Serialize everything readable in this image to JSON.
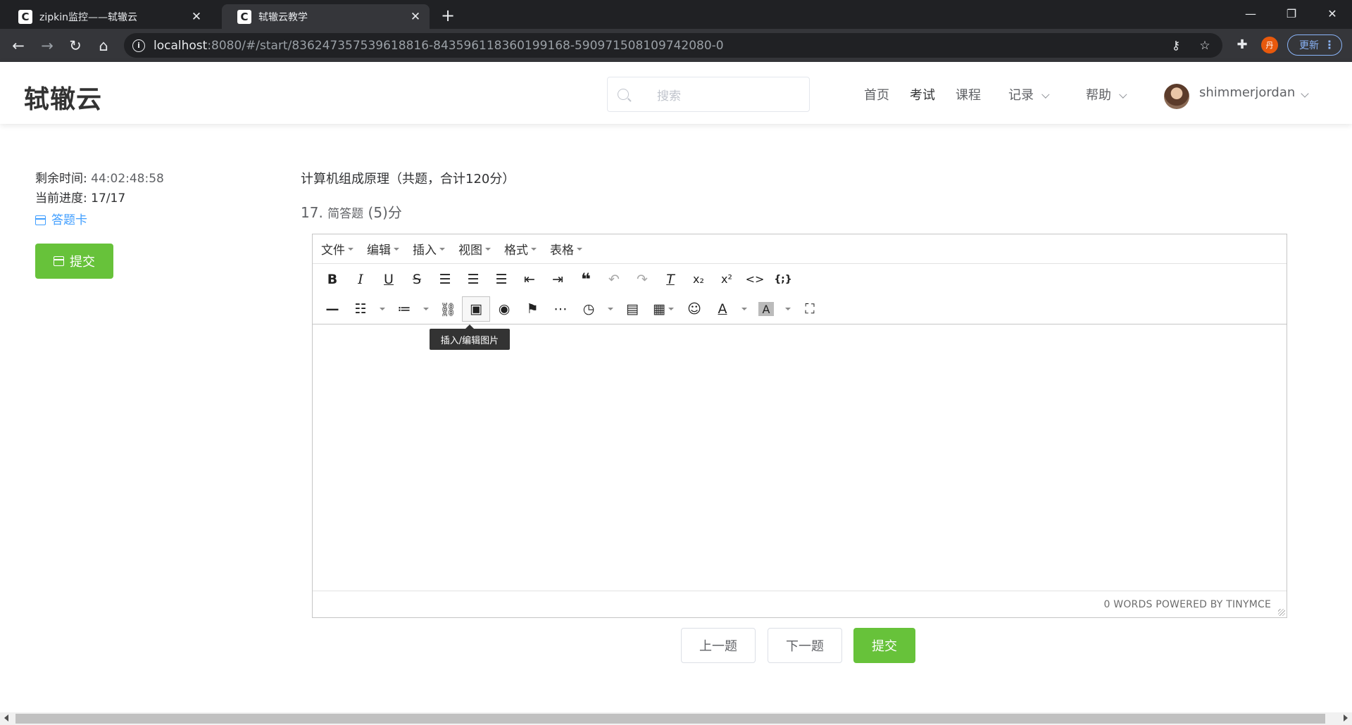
{
  "browser": {
    "tabs": [
      {
        "title": "zipkin监控——轼辙云",
        "favicon": "C",
        "active": false
      },
      {
        "title": "轼辙云教学",
        "favicon": "C",
        "active": true
      }
    ],
    "url_host": "localhost",
    "url_rest": ":8080/#/start/836247357539618816-843596118360199168-590971508109742080-0",
    "profile_initial": "丹",
    "update_label": "更新"
  },
  "site": {
    "logo": "轼辙云",
    "search_placeholder": "搜索",
    "nav": [
      "首页",
      "考试",
      "课程",
      "记录",
      "帮助"
    ],
    "active_nav": "考试",
    "username": "shimmerjordan"
  },
  "exam": {
    "time_label": "剩余时间:",
    "time_value": "44:02:48:58",
    "progress_label": "当前进度:",
    "progress_value": "17/17",
    "answer_card": "答题卡",
    "submit": "提交",
    "paper_title": "计算机组成原理（共题，合计120分）",
    "question_number": "17.",
    "question_type": "简答题",
    "question_score": "(5)分"
  },
  "editor": {
    "menus": [
      "文件",
      "编辑",
      "插入",
      "视图",
      "格式",
      "表格"
    ],
    "tooltip": "插入/编辑图片",
    "status": "0 WORDS POWERED BY TINYMCE"
  },
  "pager": {
    "prev": "上一题",
    "next": "下一题",
    "submit": "提交"
  },
  "colors": {
    "accent_green": "#67c23a",
    "link_blue": "#409eff",
    "chrome_dark": "#202124"
  }
}
